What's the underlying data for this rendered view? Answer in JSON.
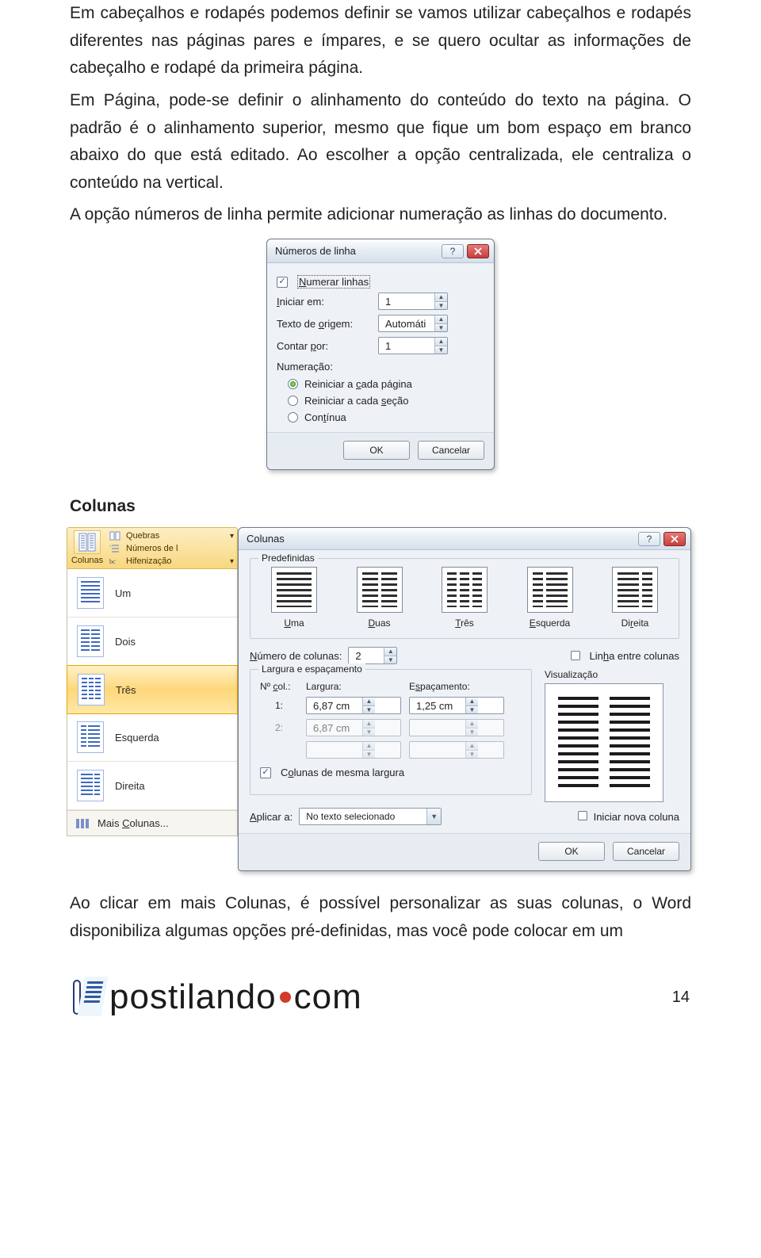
{
  "body": {
    "p1": "Em cabeçalhos e rodapés podemos definir se vamos utilizar cabeçalhos e rodapés diferentes nas páginas pares e ímpares, e se quero ocultar as informações de cabeçalho e rodapé da primeira página.",
    "p2": "Em Página, pode-se definir o alinhamento do conteúdo do texto na página. O padrão é o alinhamento superior, mesmo que fique um bom espaço em branco abaixo do que está editado. Ao escolher a opção centralizada, ele centraliza o conteúdo na vertical.",
    "p3": "A opção números de linha permite adicionar numeração as linhas do documento.",
    "heading_colunas": "Colunas",
    "p4": "Ao clicar em mais Colunas, é possível personalizar as suas colunas, o Word disponibiliza algumas opções pré-definidas, mas você pode colocar em um"
  },
  "line_numbers_dialog": {
    "title": "Números de linha",
    "numerar_linhas_label": "Numerar linhas",
    "numerar_linhas_checked": true,
    "iniciar_em_label": "Iniciar em:",
    "iniciar_em_value": "1",
    "texto_origem_label": "Texto de origem:",
    "texto_origem_value": "Automáti",
    "contar_por_label": "Contar por:",
    "contar_por_value": "1",
    "numeracao_label": "Numeração:",
    "radio_reiniciar_pagina": "Reiniciar a cada página",
    "radio_reiniciar_secao": "Reiniciar a cada seção",
    "radio_continua": "Contínua",
    "ok": "OK",
    "cancel": "Cancelar"
  },
  "gallery": {
    "btn_colunas": "Colunas",
    "menu_quebras": "Quebras",
    "menu_numeros": "Números de l",
    "menu_hifen": "Hifenização",
    "item_um": "Um",
    "item_dois": "Dois",
    "item_tres": "Três",
    "item_esquerda": "Esquerda",
    "item_direita": "Direita",
    "item_mais": "Mais Colunas..."
  },
  "columns_dialog": {
    "title": "Colunas",
    "predefinidas": "Predefinidas",
    "preset_uma": "Uma",
    "preset_duas": "Duas",
    "preset_tres": "Três",
    "preset_esquerda": "Esquerda",
    "preset_direita": "Direita",
    "numero_colunas_label": "Número de colunas:",
    "numero_colunas_value": "2",
    "linha_entre_label": "Linha entre colunas",
    "larg_esp_label": "Largura e espaçamento",
    "ncol_header": "Nº col.:",
    "largura_header": "Largura:",
    "espacamento_header": "Espaçamento:",
    "row1_n": "1:",
    "row1_largura": "6,87 cm",
    "row1_esp": "1,25 cm",
    "row2_n": "2:",
    "row2_largura": "6,87 cm",
    "mesma_largura_label": "Colunas de mesma largura",
    "mesma_largura_checked": true,
    "visualizacao_label": "Visualização",
    "aplicar_a_label": "Aplicar a:",
    "aplicar_a_value": "No texto selecionado",
    "iniciar_nova_label": "Iniciar nova coluna",
    "ok": "OK",
    "cancel": "Cancelar"
  },
  "footer": {
    "brand_part1": "postilando",
    "brand_part2": "com",
    "page_num": "14"
  }
}
